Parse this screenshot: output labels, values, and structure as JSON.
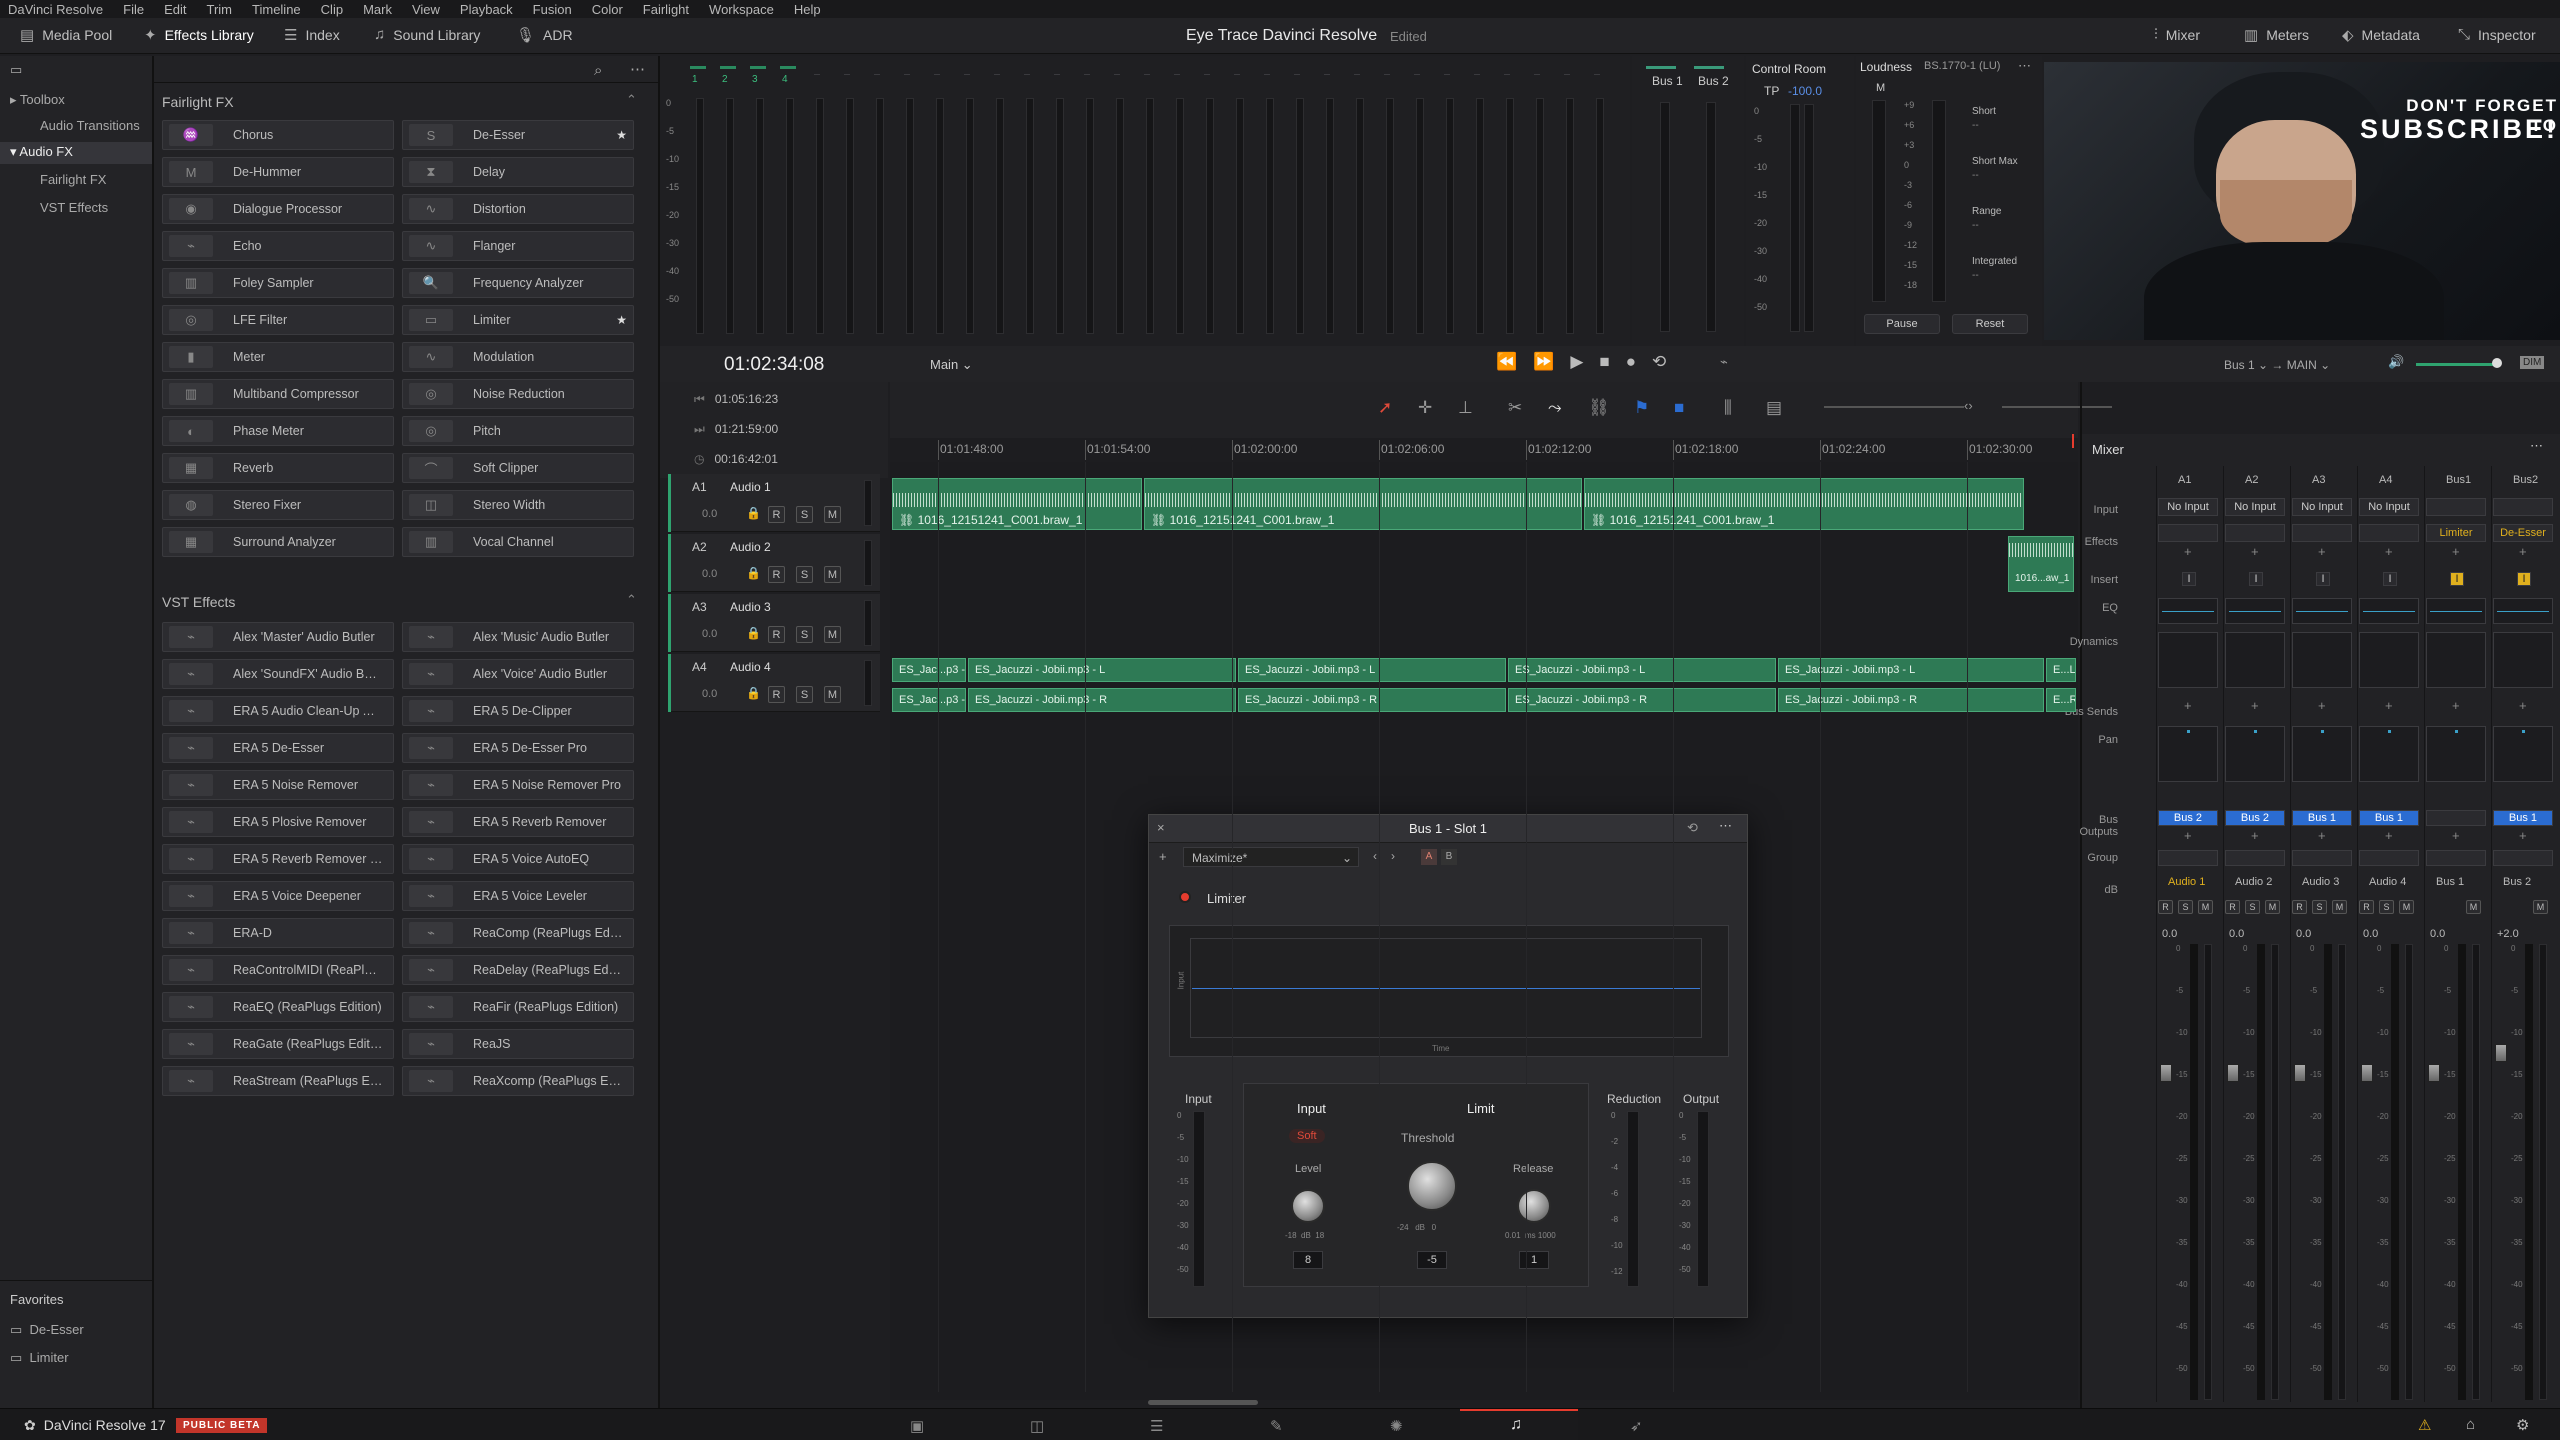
{
  "menu": [
    "DaVinci Resolve",
    "File",
    "Edit",
    "Trim",
    "Timeline",
    "Clip",
    "Mark",
    "View",
    "Playback",
    "Fusion",
    "Color",
    "Fairlight",
    "Workspace",
    "Help"
  ],
  "toolbar": {
    "media_pool": "Media Pool",
    "effects_library": "Effects Library",
    "index": "Index",
    "sound_library": "Sound Library",
    "adr": "ADR",
    "project_title": "Eye Trace Davinci Resolve",
    "status": "Edited",
    "mixer": "Mixer",
    "meters": "Meters",
    "metadata": "Metadata",
    "inspector": "Inspector"
  },
  "toolbox": {
    "toolbox": "Toolbox",
    "audio_transitions": "Audio Transitions",
    "audio_fx": "Audio FX",
    "fairlight_fx": "Fairlight FX",
    "vst_effects": "VST Effects"
  },
  "fairlight_fx": {
    "heading": "Fairlight FX",
    "left": [
      "Chorus",
      "De-Hummer",
      "Dialogue Processor",
      "Echo",
      "Foley Sampler",
      "LFE Filter",
      "Meter",
      "Multiband Compressor",
      "Phase Meter",
      "Reverb",
      "Stereo Fixer",
      "Surround Analyzer"
    ],
    "right": [
      "De-Esser",
      "Delay",
      "Distortion",
      "Flanger",
      "Frequency Analyzer",
      "Limiter",
      "Modulation",
      "Noise Reduction",
      "Pitch",
      "Soft Clipper",
      "Stereo Width",
      "Vocal Channel"
    ]
  },
  "vst_effects": {
    "heading": "VST Effects",
    "left": [
      "Alex 'Master' Audio Butler",
      "Alex 'SoundFX' Audio Butler",
      "ERA 5 Audio Clean-Up As...",
      "ERA 5 De-Esser",
      "ERA 5 Noise Remover",
      "ERA 5 Plosive Remover",
      "ERA 5 Reverb Remover Pro",
      "ERA 5 Voice Deepener",
      "ERA-D",
      "ReaControlMIDI (ReaPlug...",
      "ReaEQ (ReaPlugs Edition)",
      "ReaGate (ReaPlugs Edition)",
      "ReaStream (ReaPlugs Edit..."
    ],
    "right": [
      "Alex 'Music' Audio Butler",
      "Alex 'Voice' Audio Butler",
      "ERA 5 De-Clipper",
      "ERA 5 De-Esser Pro",
      "ERA 5 Noise Remover Pro",
      "ERA 5 Reverb Remover",
      "ERA 5 Voice AutoEQ",
      "ERA 5 Voice Leveler",
      "ReaComp (ReaPlugs Editi...",
      "ReaDelay (ReaPlugs Editi...",
      "ReaFir (ReaPlugs Edition)",
      "ReaJS",
      "ReaXcomp (ReaPlugs Editi..."
    ]
  },
  "favorites": {
    "heading": "Favorites",
    "items": [
      "De-Esser",
      "Limiter"
    ]
  },
  "meters_top": {
    "channels": [
      "1",
      "2",
      "3",
      "4"
    ],
    "bus1": "Bus 1",
    "bus2": "Bus 2",
    "scale": [
      "0",
      "-5",
      "-10",
      "-15",
      "-20",
      "-30",
      "-40",
      "-50"
    ]
  },
  "control_room": {
    "title": "Control Room",
    "tp_label": "TP",
    "tp_value": "-100.0",
    "scale": [
      "0",
      "-5",
      "-10",
      "-15",
      "-20",
      "-30",
      "-40",
      "-50"
    ]
  },
  "loudness": {
    "title": "Loudness",
    "standard": "BS.1770-1 (LU)",
    "m": "M",
    "short": "Short",
    "short_max": "Short Max",
    "range": "Range",
    "integrated": "Integrated",
    "dash": "--",
    "pause": "Pause",
    "reset": "Reset",
    "scale": [
      "+9",
      "+6",
      "+3",
      "0",
      "-3",
      "-6",
      "-9",
      "-12",
      "-15",
      "-18"
    ]
  },
  "video": {
    "line1": "DON'T FORGET TO",
    "line2": "SUBSCRIBE!"
  },
  "transport": {
    "timecode": "01:02:34:08",
    "timeline": "Main",
    "bus": "Bus 1",
    "output": "MAIN",
    "tc1": "01:05:16:23",
    "tc2": "01:21:59:00",
    "tc3": "00:16:42:01"
  },
  "ruler": [
    "01:01:48:00",
    "01:01:54:00",
    "01:02:00:00",
    "01:02:06:00",
    "01:02:12:00",
    "01:02:18:00",
    "01:02:24:00",
    "01:02:30:00"
  ],
  "tracks": [
    {
      "id": "A1",
      "name": "Audio 1",
      "vol": "0.0"
    },
    {
      "id": "A2",
      "name": "Audio 2",
      "vol": "0.0"
    },
    {
      "id": "A3",
      "name": "Audio 3",
      "vol": "0.0"
    },
    {
      "id": "A4",
      "name": "Audio 4",
      "vol": "0.0"
    }
  ],
  "track_btns": [
    "R",
    "S",
    "M"
  ],
  "clips": {
    "a1": [
      "1016_12151241_C001.braw_1",
      "1016_12151241_C001.braw_1",
      "1016_12151241_C001.braw_1"
    ],
    "a2": "1016...aw_1",
    "a4_l": [
      "ES_Jac...p3 - L",
      "ES_Jacuzzi - Jobii.mp3 - L",
      "ES_Jacuzzi - Jobii.mp3 - L",
      "ES_Jacuzzi - Jobii.mp3 - L",
      "ES_Jacuzzi - Jobii.mp3 - L",
      "E...L"
    ],
    "a4_r": [
      "ES_Jac...p3 - R",
      "ES_Jacuzzi - Jobii.mp3 - R",
      "ES_Jacuzzi - Jobii.mp3 - R",
      "ES_Jacuzzi - Jobii.mp3 - R",
      "ES_Jacuzzi - Jobii.mp3 - R",
      "E...R"
    ]
  },
  "plugin": {
    "title": "Bus 1 - Slot 1",
    "preset": "Maximize*",
    "a": "A",
    "b": "B",
    "name": "Limiter",
    "graph_y": "Input",
    "graph_x": "Time",
    "input_meter": "Input",
    "input_section": "Input",
    "soft": "Soft",
    "level": "Level",
    "level_value": "8",
    "level_scale": "-18  dB  18",
    "limit_section": "Limit",
    "threshold": "Threshold",
    "threshold_value": "-5",
    "threshold_scale": "-24   dB   0",
    "release": "Release",
    "release_value": "1",
    "release_scale": "0.01  ms 1000",
    "reduction": "Reduction",
    "output": "Output",
    "meter_scale": [
      "0",
      "-5",
      "-10",
      "-15",
      "-20",
      "-30",
      "-40",
      "-50"
    ],
    "red_scale": [
      "0",
      "-2",
      "-4",
      "-6",
      "-8",
      "-10",
      "-12"
    ]
  },
  "mixer": {
    "title": "Mixer",
    "columns": [
      "A1",
      "A2",
      "A3",
      "A4",
      "Bus1",
      "Bus2"
    ],
    "row_labels": [
      "Input",
      "Effects",
      "Insert",
      "EQ",
      "Dynamics",
      "Bus Sends",
      "Pan",
      "Bus Outputs",
      "Group",
      "dB"
    ],
    "inputs": [
      "No Input",
      "No Input",
      "No Input",
      "No Input",
      "",
      ""
    ],
    "effects": [
      "",
      "",
      "",
      "",
      "Limiter",
      "De-Esser"
    ],
    "outputs": [
      "Bus 2",
      "Bus 2",
      "Bus 1",
      "Bus 1",
      "",
      "Bus 1"
    ],
    "names": [
      "Audio 1",
      "Audio 2",
      "Audio 3",
      "Audio 4",
      "Bus 1",
      "Bus 2"
    ],
    "db": [
      "0.0",
      "0.0",
      "0.0",
      "0.0",
      "0.0",
      "+2.0"
    ],
    "scale": [
      "0",
      "-5",
      "-10",
      "-15",
      "-20",
      "-25",
      "-30",
      "-35",
      "-40",
      "-45",
      "-50"
    ]
  },
  "bottom": {
    "app": "DaVinci Resolve 17",
    "badge": "PUBLIC BETA"
  },
  "colors": {
    "accent": "#e63c2e",
    "clip": "#2e7a55",
    "highlight": "#e0b01e",
    "blue": "#2b6cd1"
  }
}
